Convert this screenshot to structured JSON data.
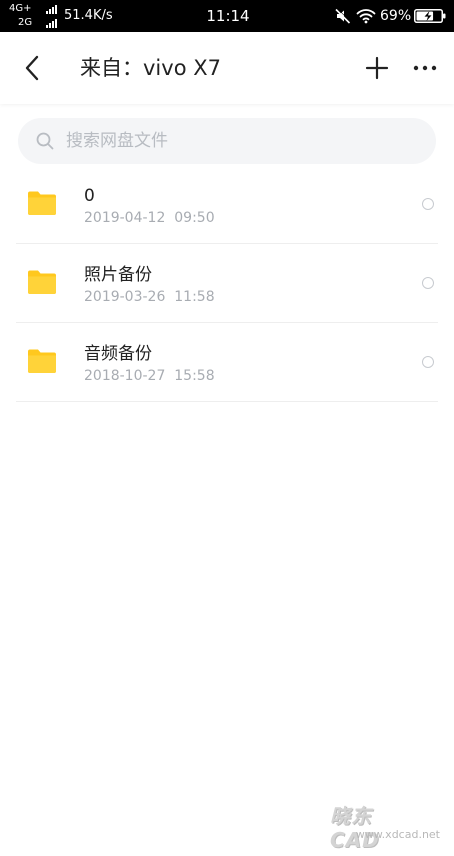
{
  "status_bar": {
    "network_top": "4G+",
    "network_bottom": "2G",
    "speed": "51.4K/s",
    "time": "11:14",
    "battery_percent": "69%",
    "battery_level": 0.69,
    "icons": [
      "signal-icon",
      "mute-icon",
      "wifi-icon",
      "battery-charging-icon"
    ]
  },
  "header": {
    "back_icon": "chevron-left-icon",
    "title": "来自：vivo X7",
    "add_icon": "plus-icon",
    "more_icon": "more-horizontal-icon"
  },
  "search": {
    "icon": "search-icon",
    "placeholder": "搜索网盘文件"
  },
  "files": [
    {
      "name": "0",
      "date": "2019-04-12  09:50",
      "icon": "folder-icon"
    },
    {
      "name": "照片备份",
      "date": "2019-03-26  11:58",
      "icon": "folder-icon"
    },
    {
      "name": "音频备份",
      "date": "2018-10-27  15:58",
      "icon": "folder-icon"
    }
  ],
  "watermark": {
    "main": "晓东 CAD",
    "url": "www.xdcad.net"
  },
  "colors": {
    "status_bar_bg": "#000000",
    "folder_yellow": "#FFC81E",
    "title_text": "#222222",
    "secondary_text": "#A8ACB2",
    "search_bg": "#F4F5F7"
  }
}
